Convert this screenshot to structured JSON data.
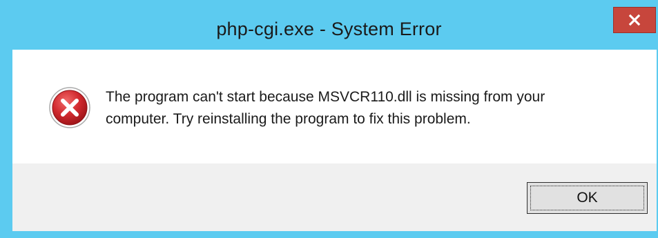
{
  "window": {
    "title": "php-cgi.exe - System Error",
    "frame_color": "#5ccbf0",
    "close_button": {
      "label": "x",
      "icon": "close-icon",
      "color": "#c7463c"
    }
  },
  "dialog": {
    "icon": "error-icon",
    "icon_color": "#c4262e",
    "message_line1": "The program can't start because MSVCR110.dll is missing from your",
    "message_line2": "computer. Try reinstalling the program to fix this problem.",
    "buttons": {
      "ok_label": "OK"
    }
  }
}
